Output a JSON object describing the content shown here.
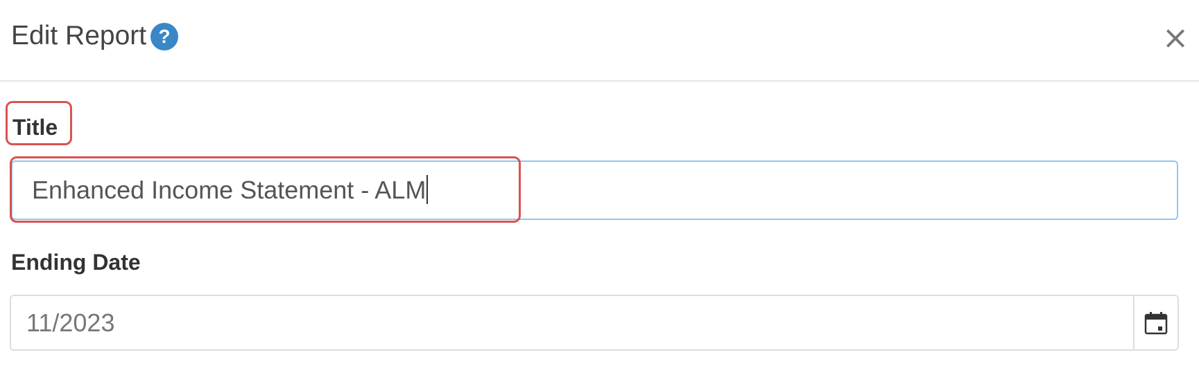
{
  "dialog": {
    "title": "Edit Report",
    "help_glyph": "?",
    "close_glyph": "×"
  },
  "form": {
    "title_label": "Title",
    "title_value": "Enhanced Income Statement - ALM",
    "ending_date_label": "Ending Date",
    "ending_date_value": "11/2023"
  },
  "icons": {
    "help": "question-circle-icon",
    "close": "close-icon",
    "calendar": "calendar-icon"
  },
  "colors": {
    "help_icon": "#3a87c8",
    "focus_border": "#8fc6f4",
    "annotation": "#d9534f"
  }
}
